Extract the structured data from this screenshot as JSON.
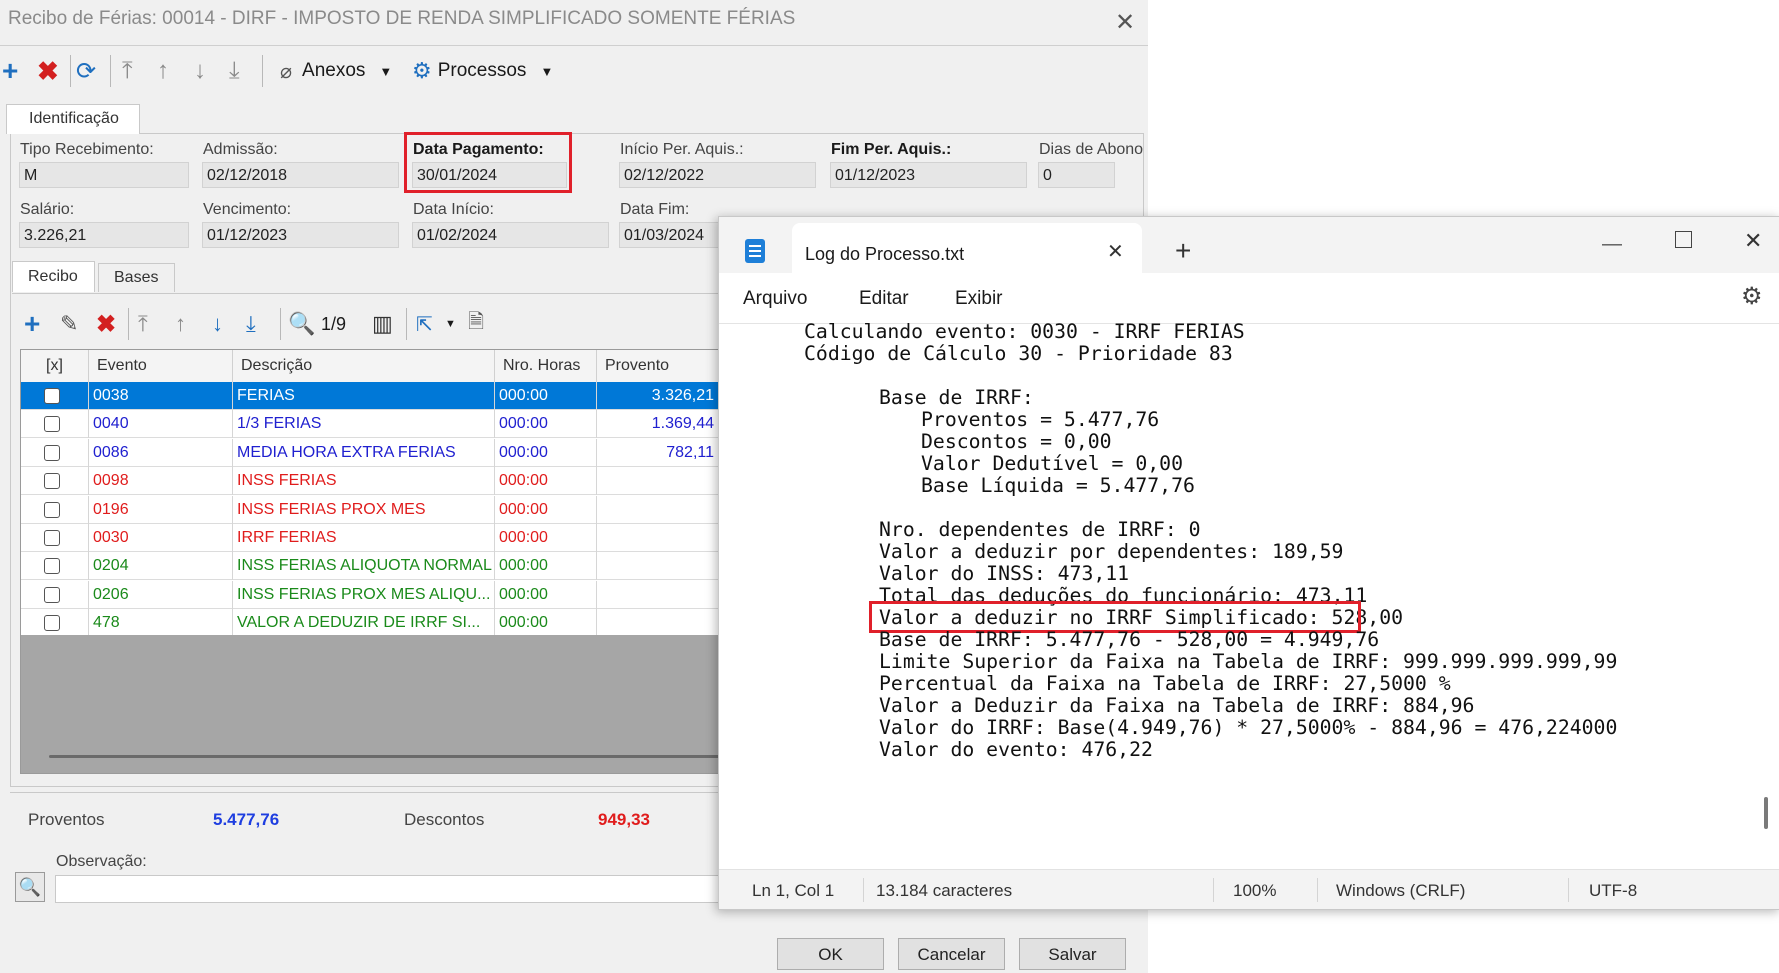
{
  "dialog": {
    "title": "Recibo de Férias: 00014 - DIRF - IMPOSTO DE RENDA SIMPLIFICADO SOMENTE FÉRIAS",
    "toolbar": {
      "attachments_label": "Anexos",
      "processes_label": "Processos"
    },
    "tab_identification": "Identificação",
    "fields": {
      "tipo_recebimento": {
        "label": "Tipo Recebimento:",
        "value": "M"
      },
      "admissao": {
        "label": "Admissão:",
        "value": "02/12/2018"
      },
      "data_pagamento": {
        "label": "Data Pagamento:",
        "value": "30/01/2024"
      },
      "inicio_per_aquis": {
        "label": "Início Per. Aquis.:",
        "value": "02/12/2022"
      },
      "fim_per_aquis": {
        "label": "Fim Per. Aquis.:",
        "value": "01/12/2023"
      },
      "dias_abono": {
        "label": "Dias de Abono",
        "value": "0"
      },
      "salario": {
        "label": "Salário:",
        "value": "3.226,21"
      },
      "vencimento": {
        "label": "Vencimento:",
        "value": "01/12/2023"
      },
      "data_inicio": {
        "label": "Data Início:",
        "value": "01/02/2024"
      },
      "data_fim": {
        "label": "Data Fim:",
        "value": "01/03/2024"
      }
    },
    "subtabs": {
      "recibo": "Recibo",
      "bases": "Bases"
    },
    "grid_toolbar": {
      "page_indicator": "1/9"
    },
    "grid": {
      "columns": [
        "[x]",
        "Evento",
        "Descrição",
        "Nro. Horas",
        "Provento"
      ],
      "rows": [
        {
          "evento": "0038",
          "descricao": "FERIAS",
          "horas": "000:00",
          "provento": "3.326,21",
          "color": "#ffffff",
          "selected": true
        },
        {
          "evento": "0040",
          "descricao": "1/3 FERIAS",
          "horas": "000:00",
          "provento": "1.369,44",
          "color": "#2020d0"
        },
        {
          "evento": "0086",
          "descricao": "MEDIA HORA EXTRA FERIAS",
          "horas": "000:00",
          "provento": "782,11",
          "color": "#2020d0"
        },
        {
          "evento": "0098",
          "descricao": "INSS FERIAS",
          "horas": "000:00",
          "provento": "",
          "color": "#e01c1c"
        },
        {
          "evento": "0196",
          "descricao": "INSS FERIAS PROX MES",
          "horas": "000:00",
          "provento": "",
          "color": "#e01c1c"
        },
        {
          "evento": "0030",
          "descricao": "IRRF FERIAS",
          "horas": "000:00",
          "provento": "",
          "color": "#e01c1c"
        },
        {
          "evento": "0204",
          "descricao": "INSS FERIAS ALIQUOTA NORMAL",
          "horas": "000:00",
          "provento": "",
          "color": "#1a8a1a"
        },
        {
          "evento": "0206",
          "descricao": "INSS FERIAS PROX MES ALIQU...",
          "horas": "000:00",
          "provento": "",
          "color": "#1a8a1a"
        },
        {
          "evento": "478",
          "descricao": "VALOR A DEDUZIR DE IRRF SI...",
          "horas": "000:00",
          "provento": "",
          "color": "#1a8a1a"
        }
      ]
    },
    "totals": {
      "proventos_label": "Proventos",
      "proventos_value": "5.477,76",
      "descontos_label": "Descontos",
      "descontos_value": "949,33"
    },
    "observacao_label": "Observação:",
    "buttons": {
      "ok": "OK",
      "cancel": "Cancelar",
      "save": "Salvar"
    },
    "colors": {
      "selection": "#0078d7",
      "highlight": "#e0202a",
      "proventos": "#1e3ee0",
      "descontos": "#e01c1c"
    }
  },
  "notepad": {
    "tab_title": "Log do Processo.txt",
    "menu": [
      "Arquivo",
      "Editar",
      "Exibir"
    ],
    "lines": [
      {
        "indent": 0,
        "text": "Calculando evento: 0030 - IRRF FERIAS"
      },
      {
        "indent": 0,
        "text": "Código de Cálculo 30 - Prioridade 83"
      },
      {
        "indent": 0,
        "text": ""
      },
      {
        "indent": 1,
        "text": "Base de IRRF:"
      },
      {
        "indent": 2,
        "text": "Proventos = 5.477,76"
      },
      {
        "indent": 2,
        "text": "Descontos = 0,00"
      },
      {
        "indent": 2,
        "text": "Valor Dedutível = 0,00"
      },
      {
        "indent": 2,
        "text": "Base Líquida = 5.477,76"
      },
      {
        "indent": 0,
        "text": ""
      },
      {
        "indent": 1,
        "text": "Nro. dependentes de IRRF: 0"
      },
      {
        "indent": 1,
        "text": "Valor a deduzir por dependentes: 189,59"
      },
      {
        "indent": 1,
        "text": "Valor do INSS: 473,11"
      },
      {
        "indent": 1,
        "text": "Total das deduções do funcionário: 473,11"
      },
      {
        "indent": 1,
        "text": "Valor a deduzir no IRRF Simplificado: 528,00",
        "highlight": true
      },
      {
        "indent": 1,
        "text": "Base de IRRF: 5.477,76 - 528,00 = 4.949,76"
      },
      {
        "indent": 1,
        "text": "Limite Superior da Faixa na Tabela de IRRF: 999.999.999.999,99"
      },
      {
        "indent": 1,
        "text": "Percentual da Faixa na Tabela de IRRF: 27,5000 %"
      },
      {
        "indent": 1,
        "text": "Valor a Deduzir da Faixa na Tabela de IRRF: 884,96"
      },
      {
        "indent": 1,
        "text": "Valor do IRRF: Base(4.949,76) * 27,5000% - 884,96 = 476,224000"
      },
      {
        "indent": 1,
        "text": "Valor do evento: 476,22"
      }
    ],
    "status": {
      "position": "Ln 1, Col 1",
      "chars": "13.184 caracteres",
      "zoom": "100%",
      "line_ending": "Windows (CRLF)",
      "encoding": "UTF-8"
    }
  }
}
